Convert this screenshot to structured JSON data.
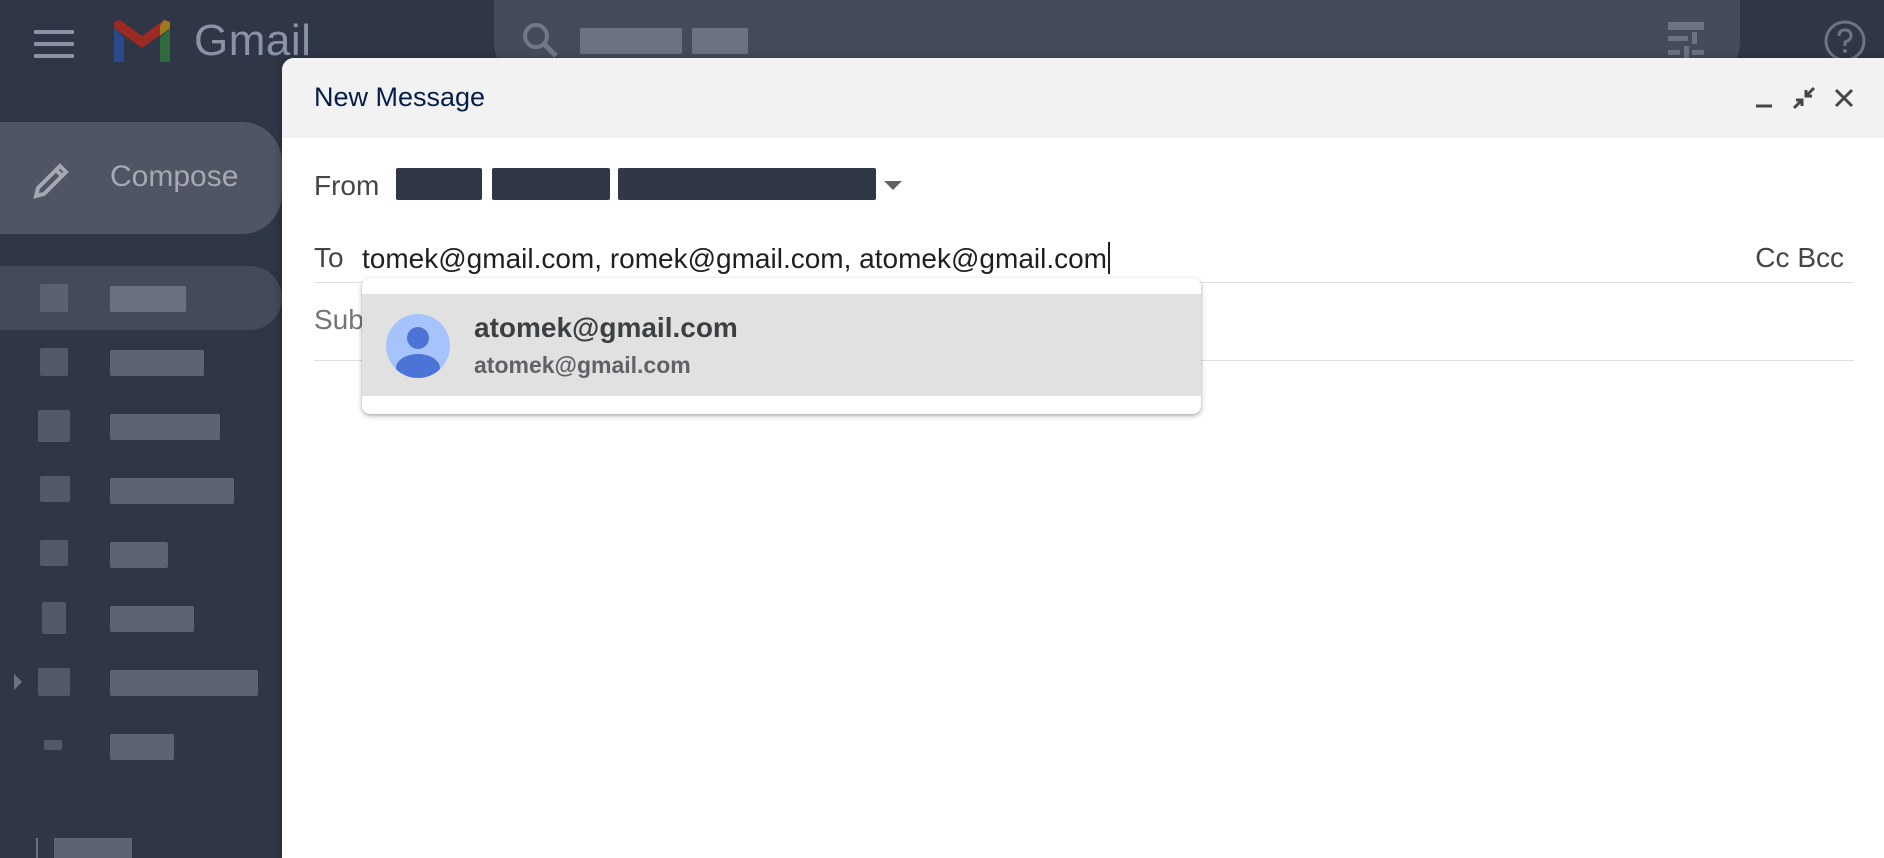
{
  "app": {
    "name": "Gmail"
  },
  "sidebar": {
    "compose_label": "Compose"
  },
  "compose": {
    "title": "New Message",
    "from_label": "From",
    "to_label": "To",
    "to_value": "tomek@gmail.com, romek@gmail.com, atomek@gmail.com",
    "cc_label": "Cc",
    "bcc_label": "Bcc",
    "subject_placeholder": "Subject"
  },
  "autocomplete": {
    "suggestions": [
      {
        "name": "atomek@gmail.com",
        "email": "atomek@gmail.com"
      }
    ]
  },
  "colors": {
    "app_background": "#2f3747",
    "dialog_background": "#ffffff",
    "header_background": "#f2f2f2",
    "suggestion_highlight": "#e1e1e1",
    "avatar_blue": "#4c74d6"
  },
  "icons": {
    "menu": "hamburger-menu-icon",
    "logo": "gmail-logo-icon",
    "search": "search-icon",
    "filter": "search-options-icon",
    "help": "help-icon",
    "compose": "pencil-icon",
    "minimize": "minimize-icon",
    "exit_fullscreen": "exit-fullscreen-icon",
    "close": "close-icon",
    "contact": "person-avatar-icon"
  }
}
